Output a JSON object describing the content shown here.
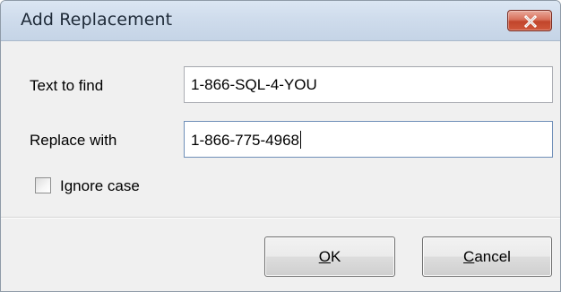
{
  "window": {
    "title": "Add Replacement"
  },
  "form": {
    "find_label": "Text to find",
    "find_value": "1-866-SQL-4-YOU",
    "replace_label": "Replace with",
    "replace_value": "1-866-775-4968",
    "ignore_case_label": "Ignore case",
    "ignore_case_checked": false
  },
  "buttons": {
    "ok_mnemonic": "O",
    "ok_rest": "K",
    "cancel_mnemonic": "C",
    "cancel_rest": "ancel"
  },
  "icons": {
    "close": "close-icon",
    "close_button_color": "#c9502f"
  }
}
